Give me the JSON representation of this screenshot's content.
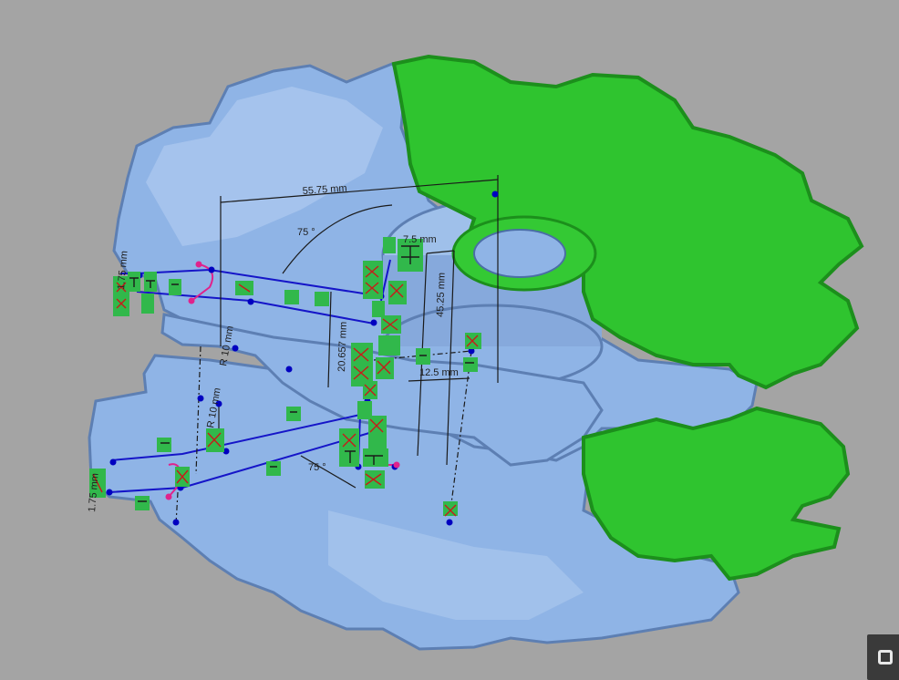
{
  "viewport": {
    "background": "#a4a4a4",
    "colors": {
      "scan_body": "#8fb4e6",
      "scan_shadow": "#5d7fb3",
      "scan_highlight": "#b8d0f2",
      "region_selected": "#2fc42f",
      "region_selected_dark": "#1c8f1c",
      "sketch_line": "#1515c8",
      "sketch_point": "#0000c0",
      "constraint_badge": "#31b84b",
      "constraint_mark": "#c81a1a",
      "arc_handle": "#e0228c",
      "dimension_line": "#1a1a1a"
    }
  },
  "dimensions": {
    "width_top": "55.75 mm",
    "angle_top": "75 °",
    "offset_top": "7.5 mm",
    "height_right": "45.25 mm",
    "depth_center": "20.657 mm",
    "offset_right": "12.5 mm",
    "radius_upper": "R 10 mm",
    "radius_lower": "R 10 mm",
    "angle_bottom": "75 °",
    "thickness_left_top": "1.75 mm",
    "thickness_left_bottom": "1.75 mm"
  },
  "toolbar": {
    "corner_icon": "view-toggle-icon"
  }
}
